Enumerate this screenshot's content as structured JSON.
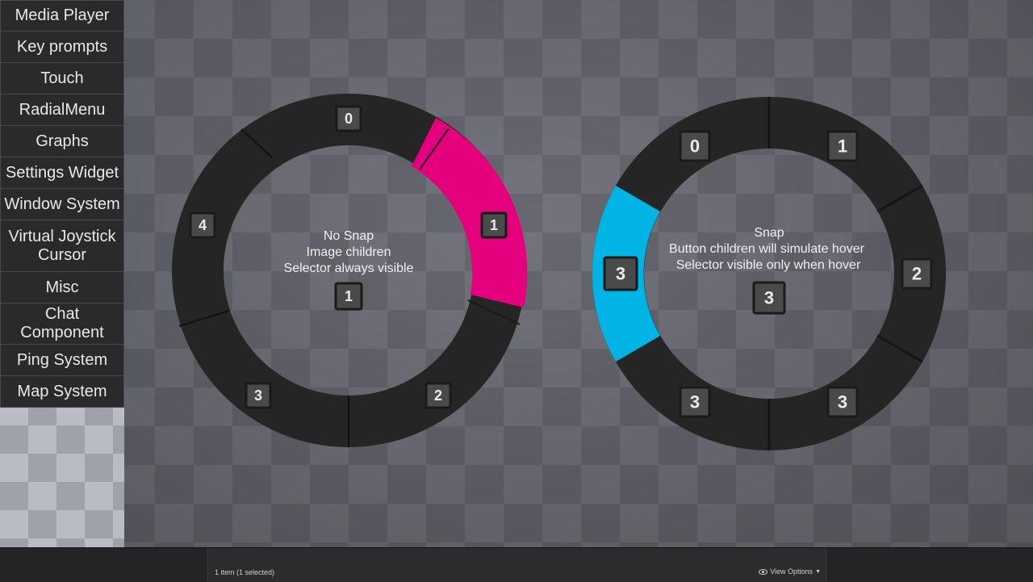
{
  "menu": {
    "items": [
      {
        "label": "Media Player"
      },
      {
        "label": "Key prompts"
      },
      {
        "label": "Touch"
      },
      {
        "label": "RadialMenu"
      },
      {
        "label": "Graphs"
      },
      {
        "label": "Settings Widget"
      },
      {
        "label": "Window System"
      },
      {
        "label": "Virtual Joystick Cursor"
      },
      {
        "label": "Misc"
      },
      {
        "label": "Chat Component"
      },
      {
        "label": "Ping System"
      },
      {
        "label": "Map System"
      }
    ]
  },
  "radial_left": {
    "caption_lines": [
      "No Snap",
      "Image children",
      "Selector always visible"
    ],
    "center_badge": "1",
    "badges": [
      "0",
      "1",
      "2",
      "3",
      "4"
    ],
    "selector_color": "#e5007e",
    "selected_index": 1
  },
  "radial_right": {
    "caption_lines": [
      "Snap",
      "Button children will simulate hover",
      "Selector visible only when hover"
    ],
    "center_badge": "3",
    "badges": [
      "0",
      "1",
      "2",
      "3",
      "3",
      "3"
    ],
    "selector_color": "#00b4e6",
    "selected_index": 3
  },
  "status_bar": {
    "item_count": "1 item (1 selected)",
    "view_options": "View Options",
    "view_options_icon": "eye-icon"
  }
}
